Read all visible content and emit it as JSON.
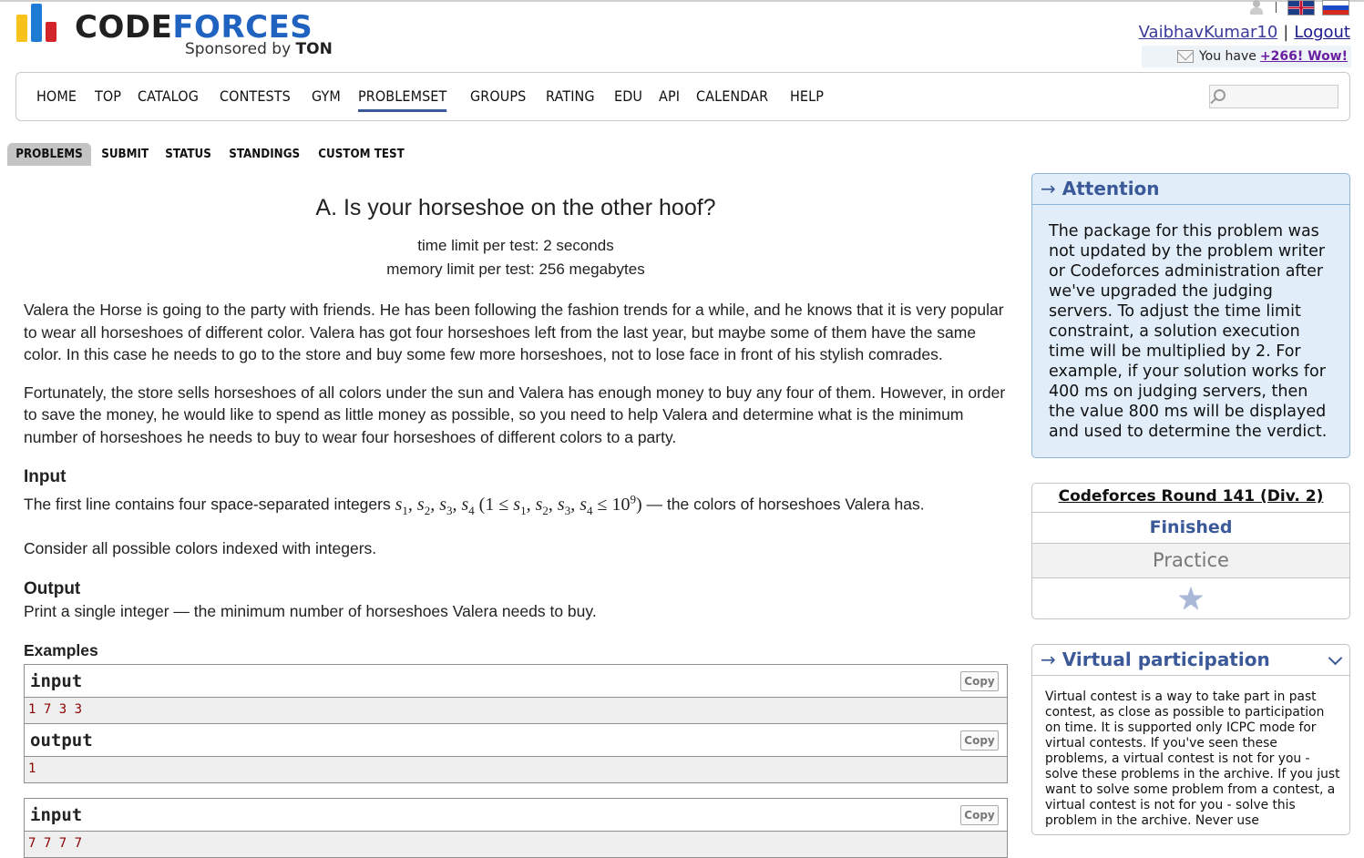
{
  "header": {
    "logo_code": "CODE",
    "logo_forces": "FORCES",
    "sponsored_by": "Sponsored by",
    "sponsor_name": "TON",
    "username": "VaibhavKumar10",
    "separator": "|",
    "logout": "Logout",
    "mail_prefix": "You have",
    "mail_link": "+266! Wow!"
  },
  "main_menu": {
    "items": [
      "HOME",
      "TOP",
      "CATALOG",
      "CONTESTS",
      "GYM",
      "PROBLEMSET",
      "GROUPS",
      "RATING",
      "EDU",
      "API",
      "CALENDAR",
      "HELP"
    ],
    "active": "PROBLEMSET"
  },
  "second_menu": {
    "items": [
      "PROBLEMS",
      "SUBMIT",
      "STATUS",
      "STANDINGS",
      "CUSTOM TEST"
    ],
    "active": "PROBLEMS"
  },
  "problem": {
    "title": "A. Is your horseshoe on the other hoof?",
    "time_limit": "time limit per test: 2 seconds",
    "memory_limit": "memory limit per test: 256 megabytes",
    "statement_1": "Valera the Horse is going to the party with friends. He has been following the fashion trends for a while, and he knows that it is very popular to wear all horseshoes of different color. Valera has got four horseshoes left from the last year, but maybe some of them have the same color. In this case he needs to go to the store and buy some few more horseshoes, not to lose face in front of his stylish comrades.",
    "statement_2": "Fortunately, the store sells horseshoes of all colors under the sun and Valera has enough money to buy any four of them. However, in order to save the money, he would like to spend as little money as possible, so you need to help Valera and determine what is the minimum number of horseshoes he needs to buy to wear four horseshoes of different colors to a party.",
    "input_title": "Input",
    "input_text_before": "The first line contains four space-separated integers",
    "input_text_after": "— the colors of horseshoes Valera has.",
    "input_note": "Consider all possible colors indexed with integers.",
    "output_title": "Output",
    "output_text": "Print a single integer — the minimum number of horseshoes Valera needs to buy.",
    "examples_title": "Examples"
  },
  "examples": [
    {
      "input_label": "input",
      "input": "1 7 3 3",
      "output_label": "output",
      "output": "1",
      "copy": "Copy"
    },
    {
      "input_label": "input",
      "input": "7 7 7 7",
      "copy": "Copy"
    }
  ],
  "sidebar": {
    "attention_title": "Attention",
    "attention_text": "The package for this problem was not updated by the problem writer or Codeforces administration after we've upgraded the judging servers. To adjust the time limit constraint, a solution execution time will be multiplied by 2. For example, if your solution works for 400 ms on judging servers, then the value 800 ms will be displayed and used to determine the verdict.",
    "round_title": "Codeforces Round 141 (Div. 2)",
    "round_status": "Finished",
    "round_practice": "Practice",
    "virtual_title": "Virtual participation",
    "virtual_text": "Virtual contest is a way to take part in past contest, as close as possible to participation on time. It is supported only ICPC mode for virtual contests. If you've seen these problems, a virtual contest is not for you - solve these problems in the archive. If you just want to solve some problem from a contest, a virtual contest is not for you - solve this problem in the archive. Never use"
  },
  "colors": {
    "brand_blue": "#1f62c0",
    "link_blue": "#3b5998",
    "attention_bg": "#e1eef9",
    "sample_text": "#8b0000"
  }
}
